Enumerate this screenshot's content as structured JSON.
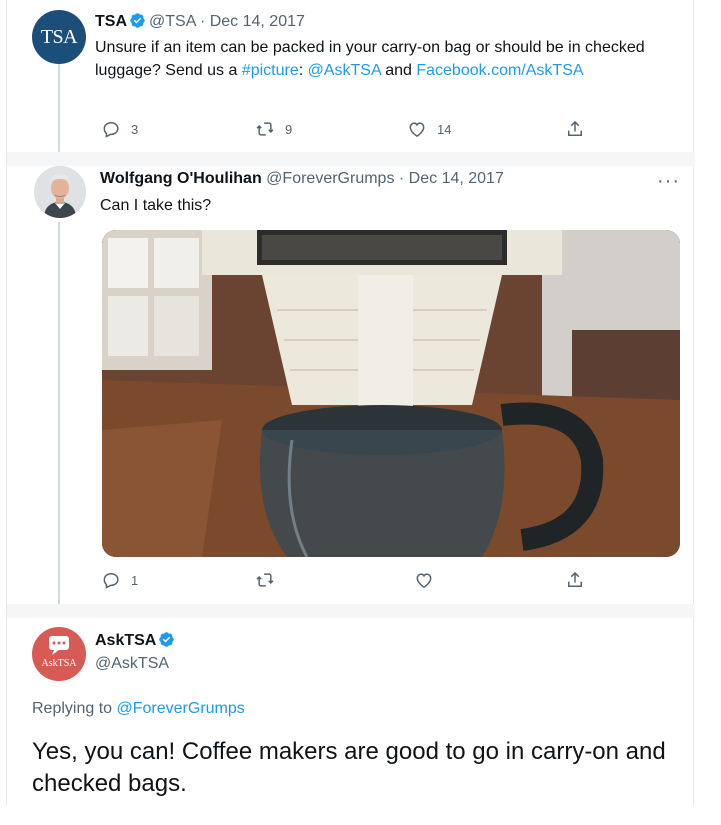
{
  "tweet1": {
    "avatar_text": "TSA",
    "name": "TSA",
    "handle": "@TSA",
    "sep": "·",
    "date": "Dec 14, 2017",
    "text_a": "Unsure if an item can be packed in your carry-on bag or should be in checked luggage? Send us a ",
    "link_hashtag": "#picture",
    "text_b": ": ",
    "link_mention": "@AskTSA",
    "text_c": " and ",
    "link_url": "Facebook.com/AskTSA",
    "reply_count": "3",
    "retweet_count": "9",
    "like_count": "14"
  },
  "tweet2": {
    "name": "Wolfgang O'Houlihan",
    "handle": "@ForeverGrumps",
    "sep": "·",
    "date": "Dec 14, 2017",
    "text": "Can I take this?",
    "more": "···",
    "reply_count": "1"
  },
  "tweet3": {
    "avatar_text": "AskTSA",
    "name": "AskTSA",
    "handle": "@AskTSA",
    "replying_prefix": "Replying to ",
    "replying_handle": "@ForeverGrumps",
    "text": "Yes, you can! Coffee makers are good to go in carry-on and checked bags."
  },
  "colors": {
    "link": "#1d9bf0",
    "verified": "#1d9bf0",
    "tsa_avatar": "#1b4f7a",
    "asktsa_avatar": "#d85a54"
  },
  "icons": [
    "reply-icon",
    "retweet-icon",
    "like-icon",
    "share-icon",
    "verified-badge-icon",
    "more-icon",
    "chat-bubble-icon"
  ]
}
